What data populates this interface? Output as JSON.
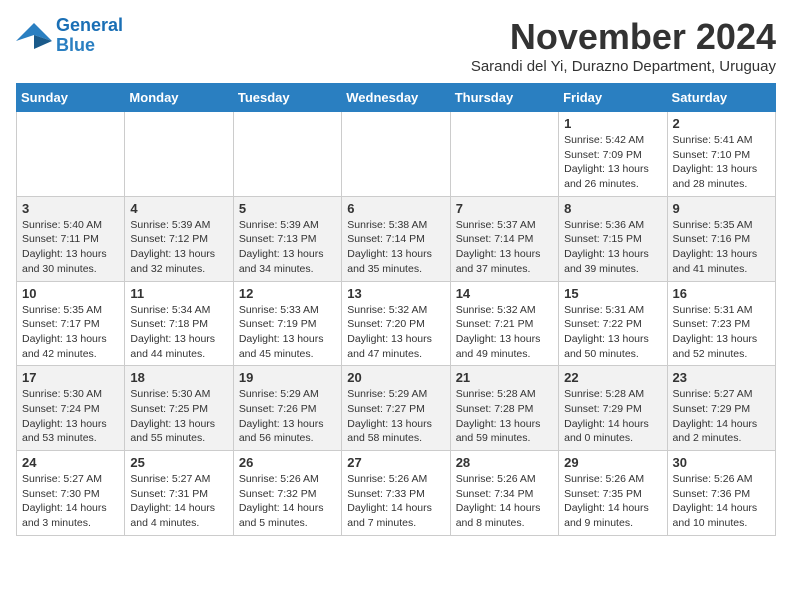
{
  "logo": {
    "line1": "General",
    "line2": "Blue"
  },
  "title": "November 2024",
  "subtitle": "Sarandi del Yi, Durazno Department, Uruguay",
  "weekdays": [
    "Sunday",
    "Monday",
    "Tuesday",
    "Wednesday",
    "Thursday",
    "Friday",
    "Saturday"
  ],
  "weeks": [
    [
      {
        "day": "",
        "info": ""
      },
      {
        "day": "",
        "info": ""
      },
      {
        "day": "",
        "info": ""
      },
      {
        "day": "",
        "info": ""
      },
      {
        "day": "",
        "info": ""
      },
      {
        "day": "1",
        "info": "Sunrise: 5:42 AM\nSunset: 7:09 PM\nDaylight: 13 hours and 26 minutes."
      },
      {
        "day": "2",
        "info": "Sunrise: 5:41 AM\nSunset: 7:10 PM\nDaylight: 13 hours and 28 minutes."
      }
    ],
    [
      {
        "day": "3",
        "info": "Sunrise: 5:40 AM\nSunset: 7:11 PM\nDaylight: 13 hours and 30 minutes."
      },
      {
        "day": "4",
        "info": "Sunrise: 5:39 AM\nSunset: 7:12 PM\nDaylight: 13 hours and 32 minutes."
      },
      {
        "day": "5",
        "info": "Sunrise: 5:39 AM\nSunset: 7:13 PM\nDaylight: 13 hours and 34 minutes."
      },
      {
        "day": "6",
        "info": "Sunrise: 5:38 AM\nSunset: 7:14 PM\nDaylight: 13 hours and 35 minutes."
      },
      {
        "day": "7",
        "info": "Sunrise: 5:37 AM\nSunset: 7:14 PM\nDaylight: 13 hours and 37 minutes."
      },
      {
        "day": "8",
        "info": "Sunrise: 5:36 AM\nSunset: 7:15 PM\nDaylight: 13 hours and 39 minutes."
      },
      {
        "day": "9",
        "info": "Sunrise: 5:35 AM\nSunset: 7:16 PM\nDaylight: 13 hours and 41 minutes."
      }
    ],
    [
      {
        "day": "10",
        "info": "Sunrise: 5:35 AM\nSunset: 7:17 PM\nDaylight: 13 hours and 42 minutes."
      },
      {
        "day": "11",
        "info": "Sunrise: 5:34 AM\nSunset: 7:18 PM\nDaylight: 13 hours and 44 minutes."
      },
      {
        "day": "12",
        "info": "Sunrise: 5:33 AM\nSunset: 7:19 PM\nDaylight: 13 hours and 45 minutes."
      },
      {
        "day": "13",
        "info": "Sunrise: 5:32 AM\nSunset: 7:20 PM\nDaylight: 13 hours and 47 minutes."
      },
      {
        "day": "14",
        "info": "Sunrise: 5:32 AM\nSunset: 7:21 PM\nDaylight: 13 hours and 49 minutes."
      },
      {
        "day": "15",
        "info": "Sunrise: 5:31 AM\nSunset: 7:22 PM\nDaylight: 13 hours and 50 minutes."
      },
      {
        "day": "16",
        "info": "Sunrise: 5:31 AM\nSunset: 7:23 PM\nDaylight: 13 hours and 52 minutes."
      }
    ],
    [
      {
        "day": "17",
        "info": "Sunrise: 5:30 AM\nSunset: 7:24 PM\nDaylight: 13 hours and 53 minutes."
      },
      {
        "day": "18",
        "info": "Sunrise: 5:30 AM\nSunset: 7:25 PM\nDaylight: 13 hours and 55 minutes."
      },
      {
        "day": "19",
        "info": "Sunrise: 5:29 AM\nSunset: 7:26 PM\nDaylight: 13 hours and 56 minutes."
      },
      {
        "day": "20",
        "info": "Sunrise: 5:29 AM\nSunset: 7:27 PM\nDaylight: 13 hours and 58 minutes."
      },
      {
        "day": "21",
        "info": "Sunrise: 5:28 AM\nSunset: 7:28 PM\nDaylight: 13 hours and 59 minutes."
      },
      {
        "day": "22",
        "info": "Sunrise: 5:28 AM\nSunset: 7:29 PM\nDaylight: 14 hours and 0 minutes."
      },
      {
        "day": "23",
        "info": "Sunrise: 5:27 AM\nSunset: 7:29 PM\nDaylight: 14 hours and 2 minutes."
      }
    ],
    [
      {
        "day": "24",
        "info": "Sunrise: 5:27 AM\nSunset: 7:30 PM\nDaylight: 14 hours and 3 minutes."
      },
      {
        "day": "25",
        "info": "Sunrise: 5:27 AM\nSunset: 7:31 PM\nDaylight: 14 hours and 4 minutes."
      },
      {
        "day": "26",
        "info": "Sunrise: 5:26 AM\nSunset: 7:32 PM\nDaylight: 14 hours and 5 minutes."
      },
      {
        "day": "27",
        "info": "Sunrise: 5:26 AM\nSunset: 7:33 PM\nDaylight: 14 hours and 7 minutes."
      },
      {
        "day": "28",
        "info": "Sunrise: 5:26 AM\nSunset: 7:34 PM\nDaylight: 14 hours and 8 minutes."
      },
      {
        "day": "29",
        "info": "Sunrise: 5:26 AM\nSunset: 7:35 PM\nDaylight: 14 hours and 9 minutes."
      },
      {
        "day": "30",
        "info": "Sunrise: 5:26 AM\nSunset: 7:36 PM\nDaylight: 14 hours and 10 minutes."
      }
    ]
  ]
}
